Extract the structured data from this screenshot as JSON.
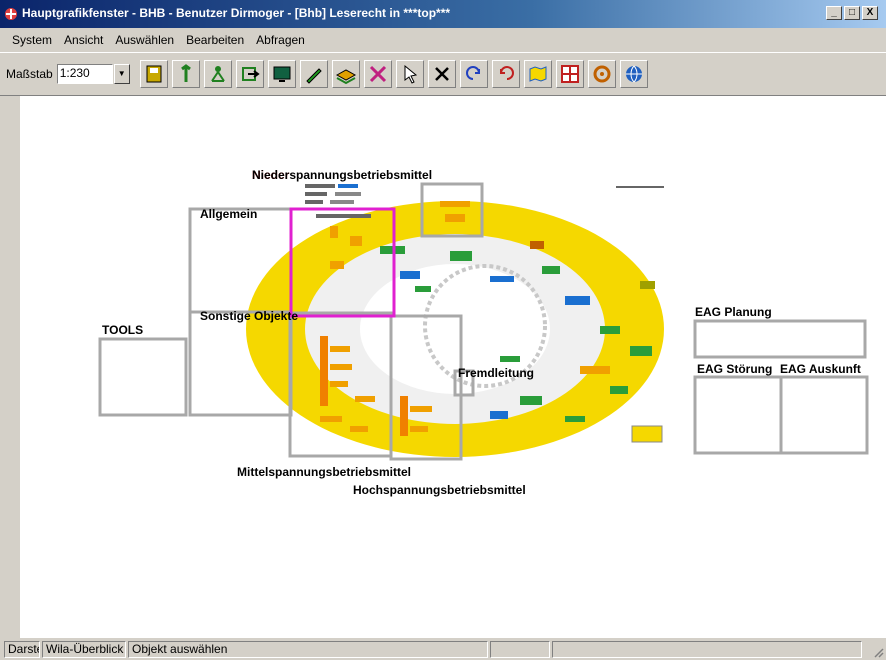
{
  "window": {
    "title": "Hauptgrafikfenster - BHB - Benutzer Dirmoger  -  [Bhb] Leserecht in ***top***",
    "buttons": {
      "minimize": "_",
      "maximize": "□",
      "close": "X"
    }
  },
  "menubar": {
    "items": [
      "System",
      "Ansicht",
      "Auswählen",
      "Bearbeiten",
      "Abfragen"
    ]
  },
  "toolbar": {
    "scale_label": "Maßstab",
    "scale_value": "1:230",
    "buttons": [
      {
        "name": "save-icon",
        "color": "#c8a800"
      },
      {
        "name": "tools-icon",
        "color": "#208020"
      },
      {
        "name": "network-icon",
        "color": "#208020"
      },
      {
        "name": "export-icon",
        "color": "#208020"
      },
      {
        "name": "screen-icon",
        "color": "#106040"
      },
      {
        "name": "edit-icon",
        "color": "#20a020"
      },
      {
        "name": "layer-icon",
        "color": "#e0a000"
      },
      {
        "name": "delete-pattern-icon",
        "color": "#c02080"
      },
      {
        "name": "pointer-icon",
        "color": "#000000"
      },
      {
        "name": "close-icon",
        "color": "#000000"
      },
      {
        "name": "undo-icon",
        "color": "#2040c0"
      },
      {
        "name": "redo-icon",
        "color": "#c02020"
      },
      {
        "name": "map-icon",
        "color": "#2060c0"
      },
      {
        "name": "grid-icon",
        "color": "#c02020"
      },
      {
        "name": "settings-icon",
        "color": "#c06000"
      },
      {
        "name": "globe-icon",
        "color": "#2060c0"
      }
    ]
  },
  "canvas": {
    "labels": {
      "niederspannung": "Niederspannungsbetriebsmittel",
      "allgemein": "Allgemein",
      "sonstige": "Sonstige Objekte",
      "tools": "TOOLS",
      "fremdleitung": "Fremdleitung",
      "mittelspannung": "Mittelspannungsbetriebsmittel",
      "hochspannung": "Hochspannungsbetriebsmittel",
      "eag_planung": "EAG Planung",
      "eag_stoerung": "EAG Störung",
      "eag_auskunft": "EAG Auskunft"
    },
    "colors": {
      "ring": "#f5d800",
      "highlight": "#e020d0",
      "box": "#a8a8a8",
      "red_label": "#cc0000"
    }
  },
  "statusbar": {
    "cells": [
      "Darstell",
      "Wila-Überblick",
      "Objekt auswählen",
      "",
      ""
    ]
  }
}
